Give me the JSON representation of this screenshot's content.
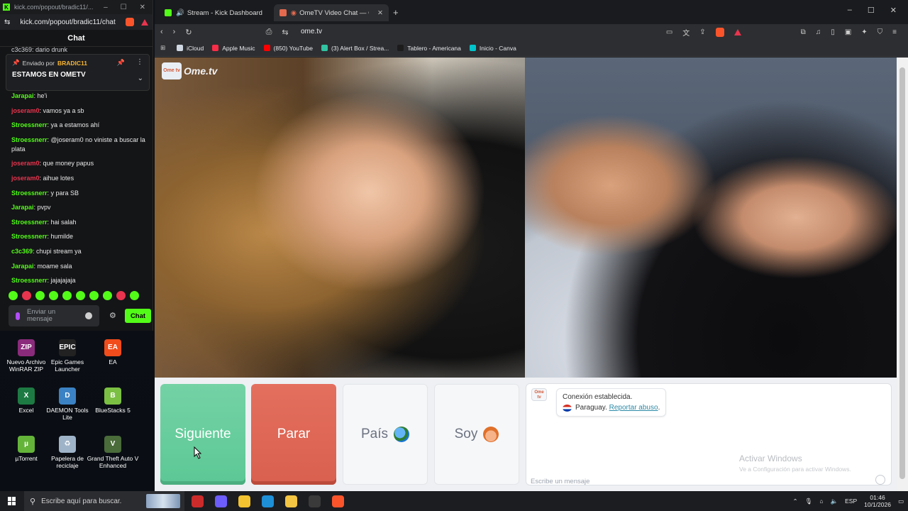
{
  "kick_window": {
    "title": "kick.com/popout/bradic11/...",
    "url": "kick.com/popout/bradic11/chat",
    "chat_header": "Chat",
    "cut_message": "c3c369: dario drunk",
    "pinned": {
      "sent_by_prefix": "Enviado por",
      "sent_by_user": "BRADIC11",
      "message": "ESTAMOS EN OMETV"
    },
    "messages": [
      {
        "user": "Jarapai",
        "color": "#53fc18",
        "text": ": he'i"
      },
      {
        "user": "joseram0",
        "color": "#e8344e",
        "text": ": vamos ya a sb"
      },
      {
        "user": "Stroessnerr",
        "color": "#53fc18",
        "text": ": ya a estamos ahí"
      },
      {
        "user": "Stroessnerr",
        "color": "#53fc18",
        "text": ": @joseram0 no viniste a buscar la plata"
      },
      {
        "user": "joseram0",
        "color": "#e8344e",
        "text": ": que money papus"
      },
      {
        "user": "joseram0",
        "color": "#e8344e",
        "text": ": aihue lotes"
      },
      {
        "user": "Stroessnerr",
        "color": "#53fc18",
        "text": ": y para SB"
      },
      {
        "user": "Jarapai",
        "color": "#53fc18",
        "text": ": pvpv"
      },
      {
        "user": "Stroessnerr",
        "color": "#53fc18",
        "text": ": hai salah"
      },
      {
        "user": "Stroessnerr",
        "color": "#53fc18",
        "text": ": humilde"
      },
      {
        "user": "c3c369",
        "color": "#53fc18",
        "text": ": chupi stream ya"
      },
      {
        "user": "Jarapai",
        "color": "#53fc18",
        "text": ": moame sala"
      },
      {
        "user": "Stroessnerr",
        "color": "#53fc18",
        "text": ": jajajajaja"
      }
    ],
    "input_placeholder": "Enviar un mensaje",
    "send_label": "Chat"
  },
  "desktop_icons": [
    {
      "label": "Nuevo Archivo WinRAR ZIP",
      "color": "#8b2b7c",
      "glyph": "ZIP"
    },
    {
      "label": "Epic Games Launcher",
      "color": "#222222",
      "glyph": "EPIC"
    },
    {
      "label": "EA",
      "color": "#f14c1b",
      "glyph": "EA"
    },
    {
      "label": "Excel",
      "color": "#1d7a43",
      "glyph": "X"
    },
    {
      "label": "DAEMON Tools Lite",
      "color": "#3b82c4",
      "glyph": "D"
    },
    {
      "label": "BlueStacks 5",
      "color": "#7cc043",
      "glyph": "B"
    },
    {
      "label": "µTorrent",
      "color": "#65b43a",
      "glyph": "µ"
    },
    {
      "label": "Papelera de reciclaje",
      "color": "#9fb3c8",
      "glyph": "♻"
    },
    {
      "label": "Grand Theft Auto V Enhanced",
      "color": "#4a6b3a",
      "glyph": "V"
    }
  ],
  "browser": {
    "tabs": [
      {
        "label": "Stream - Kick Dashboard",
        "color": "#53fc18"
      },
      {
        "label": "OmeTV Video Chat — Omegl",
        "color": "#e36a4f"
      }
    ],
    "url": "ome.tv",
    "bookmarks": [
      {
        "label": "iCloud",
        "color": "#cfd8e3"
      },
      {
        "label": "Apple Music",
        "color": "#fa2d48"
      },
      {
        "label": "(850) YouTube",
        "color": "#ff0000"
      },
      {
        "label": "(3) Alert Box / Strea...",
        "color": "#31c3a2"
      },
      {
        "label": "Tablero - Americana",
        "color": "#1c1c1c"
      },
      {
        "label": "Inicio - Canva",
        "color": "#00c4cc"
      }
    ]
  },
  "ometv": {
    "logo_badge": "Ome tv",
    "logo_text": "Ome.tv",
    "next_label": "Siguiente",
    "stop_label": "Parar",
    "country_label": "País",
    "country_icon": "globe-icon",
    "soy_label": "Soy",
    "soy_icon": "boy-face-icon",
    "system_logo": "Ome tv",
    "connected_text": "Conexión establecida.",
    "country_text": "Paraguay.",
    "report_text": "Reportar abuso",
    "report_suffix": ".",
    "message_placeholder": "Escribe un mensaje",
    "watermark_title": "Activar Windows",
    "watermark_sub": "Ve a Configuración para activar Windows."
  },
  "taskbar": {
    "search_placeholder": "Escribe aquí para buscar.",
    "apps": [
      {
        "name": "app-red",
        "color": "#cc2b2b"
      },
      {
        "name": "app-copilot",
        "color": "#6d5dfc"
      },
      {
        "name": "app-chrome",
        "color": "#f2c230"
      },
      {
        "name": "app-edge",
        "color": "#1e90d8"
      },
      {
        "name": "app-explorer",
        "color": "#f4c542"
      },
      {
        "name": "app-obs",
        "color": "#3a3a3a"
      },
      {
        "name": "app-brave",
        "color": "#fb542b"
      }
    ],
    "language": "ESP",
    "time": "01:46",
    "date": "10/1/2026"
  }
}
